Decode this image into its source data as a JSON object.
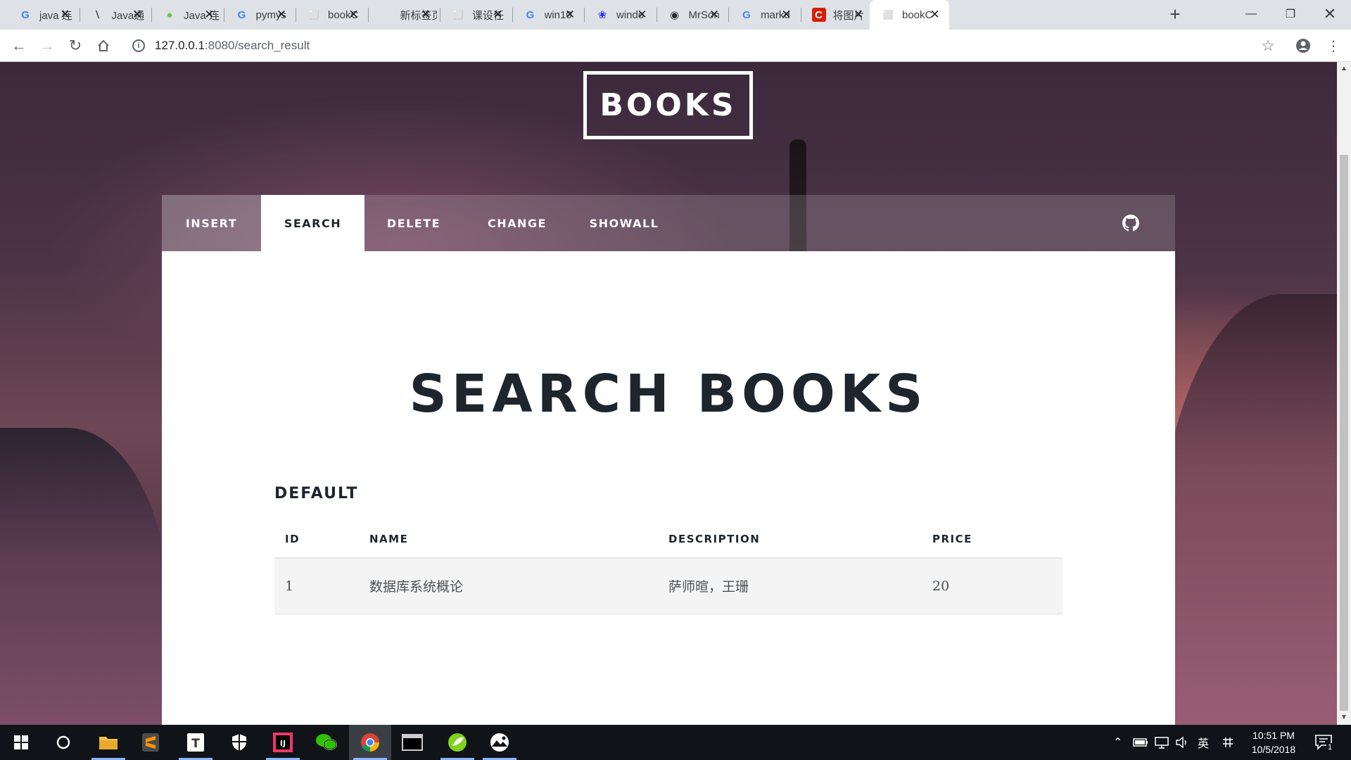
{
  "browser": {
    "tabs": [
      {
        "title": "java 连",
        "icon": "google-icon",
        "color": "#4285f4"
      },
      {
        "title": "Java通",
        "icon": "ruler-icon",
        "color": "#3c4043"
      },
      {
        "title": "Java 连",
        "icon": "green-circle-icon",
        "color": "#6cc24a"
      },
      {
        "title": "pymys",
        "icon": "google-icon",
        "color": "#4285f4"
      },
      {
        "title": "bookC",
        "icon": "page-icon",
        "color": "#5f6368"
      },
      {
        "title": "新标签页",
        "icon": "none",
        "color": "#5f6368"
      },
      {
        "title": "课设任",
        "icon": "page-icon",
        "color": "#5f6368"
      },
      {
        "title": "win10",
        "icon": "google-icon",
        "color": "#4285f4"
      },
      {
        "title": "windo",
        "icon": "baidu-paw-icon",
        "color": "#2932e1"
      },
      {
        "title": "MrSon",
        "icon": "github-icon",
        "color": "#24292e"
      },
      {
        "title": "markd",
        "icon": "google-icon",
        "color": "#4285f4"
      },
      {
        "title": "将图片",
        "icon": "c-red-icon",
        "color": "#d81e06"
      },
      {
        "title": "bookC",
        "icon": "page-icon",
        "color": "#5f6368"
      }
    ],
    "url_host": "127.0.0.1",
    "url_path": ":8080/search_result"
  },
  "site": {
    "logo": "BOOKS",
    "nav": [
      "INSERT",
      "SEARCH",
      "DELETE",
      "CHANGE",
      "SHOWALL"
    ],
    "active_nav": "SEARCH",
    "title": "SEARCH BOOKS",
    "section": "DEFAULT",
    "table": {
      "headers": [
        "ID",
        "NAME",
        "DESCRIPTION",
        "PRICE"
      ],
      "rows": [
        [
          "1",
          "数据库系统概论",
          "萨师暄，王珊",
          "20"
        ]
      ]
    }
  },
  "taskbar": {
    "clock_time": "10:51 PM",
    "clock_date": "10/5/2018",
    "ime_label": "英",
    "notification_count": "1"
  }
}
